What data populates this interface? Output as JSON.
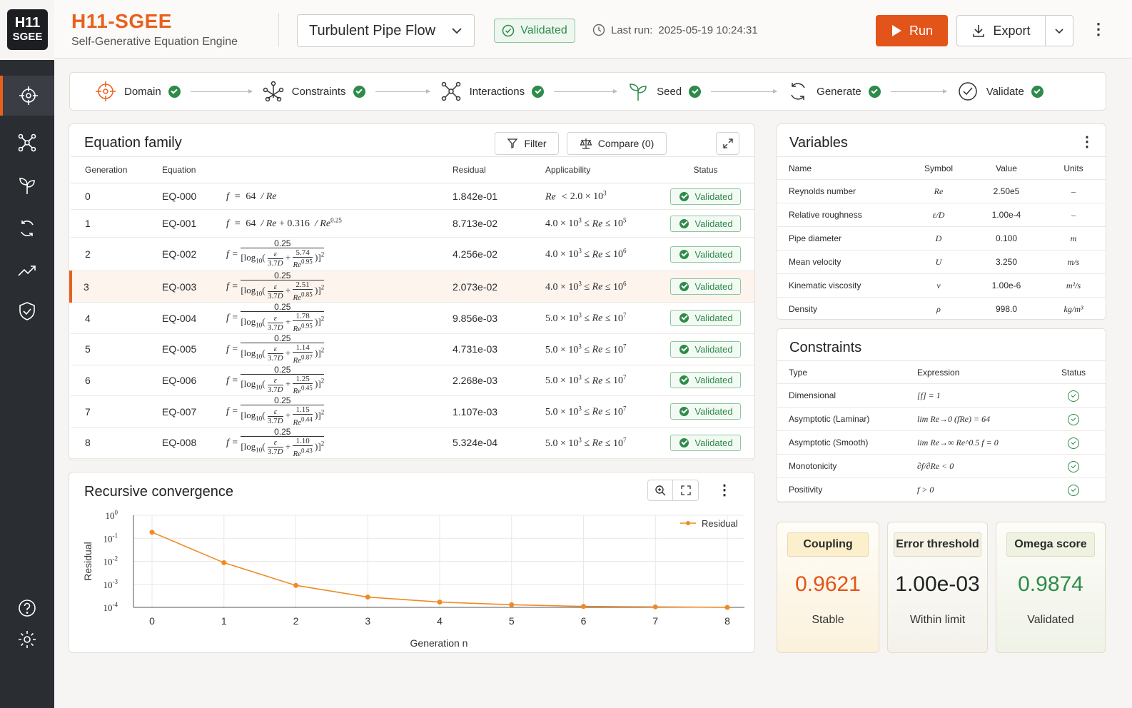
{
  "app": {
    "logo_line1": "H11",
    "logo_line2": "SGEE",
    "title": "H11-SGEE",
    "subtitle": "Self-Generative Equation Engine"
  },
  "header": {
    "dataset": "Turbulent Pipe Flow",
    "status_badge": "Validated",
    "last_run_label": "Last run:",
    "last_run_value": "2025-05-19 10:24:31",
    "run_label": "Run",
    "export_label": "Export",
    "accent": "#e3541a"
  },
  "pipeline": {
    "steps": [
      {
        "label": "Domain",
        "icon": "crosshair-icon"
      },
      {
        "label": "Constraints",
        "icon": "constraint-graph-icon"
      },
      {
        "label": "Interactions",
        "icon": "network-icon"
      },
      {
        "label": "Seed",
        "icon": "sprout-icon"
      },
      {
        "label": "Generate",
        "icon": "refresh-icon"
      },
      {
        "label": "Validate",
        "icon": "check-circle-icon"
      }
    ]
  },
  "equation_family": {
    "title": "Equation family",
    "filter_label": "Filter",
    "compare_label": "Compare (0)",
    "columns": [
      "Generation",
      "Equation",
      "",
      "Residual",
      "Applicability",
      "Status"
    ],
    "rows": [
      {
        "gen": "0",
        "id": "EQ-000",
        "residual": "1.842e-01",
        "status": "Validated"
      },
      {
        "gen": "1",
        "id": "EQ-001",
        "residual": "8.713e-02",
        "status": "Validated"
      },
      {
        "gen": "2",
        "id": "EQ-002",
        "residual": "4.256e-02",
        "status": "Validated",
        "num": "5.74",
        "exp": "0.95",
        "app_lo": "4.0",
        "app_lo_exp": "3",
        "app_hi_exp": "6"
      },
      {
        "gen": "3",
        "id": "EQ-003",
        "residual": "2.073e-02",
        "status": "Validated",
        "num": "2.51",
        "exp": "0.85",
        "app_lo": "4.0",
        "app_lo_exp": "3",
        "app_hi_exp": "6"
      },
      {
        "gen": "4",
        "id": "EQ-004",
        "residual": "9.856e-03",
        "status": "Validated",
        "num": "1.78",
        "exp": "0.95",
        "app_lo": "5.0",
        "app_lo_exp": "3",
        "app_hi_exp": "7"
      },
      {
        "gen": "5",
        "id": "EQ-005",
        "residual": "4.731e-03",
        "status": "Validated",
        "num": "1.14",
        "exp": "0.87",
        "app_lo": "5.0",
        "app_lo_exp": "3",
        "app_hi_exp": "7"
      },
      {
        "gen": "6",
        "id": "EQ-006",
        "residual": "2.268e-03",
        "status": "Validated",
        "num": "1.25",
        "exp": "0.45",
        "app_lo": "5.0",
        "app_lo_exp": "3",
        "app_hi_exp": "7"
      },
      {
        "gen": "7",
        "id": "EQ-007",
        "residual": "1.107e-03",
        "status": "Validated",
        "num": "1.15",
        "exp": "0.44",
        "app_lo": "5.0",
        "app_lo_exp": "3",
        "app_hi_exp": "7"
      },
      {
        "gen": "8",
        "id": "EQ-008",
        "residual": "5.324e-04",
        "status": "Validated",
        "num": "1.10",
        "exp": "0.43",
        "app_lo": "5.0",
        "app_lo_exp": "3",
        "app_hi_exp": "7"
      }
    ]
  },
  "convergence": {
    "title": "Recursive convergence"
  },
  "chart_data": {
    "type": "line",
    "title": "Recursive convergence",
    "xlabel": "Generation n",
    "ylabel": "Residual",
    "yscale": "log",
    "ylim": [
      0.0001,
      1
    ],
    "yticks": [
      "10^0",
      "10^-1",
      "10^-2",
      "10^-3",
      "10^-4"
    ],
    "x": [
      0,
      1,
      2,
      3,
      4,
      5,
      6,
      7,
      8
    ],
    "series": [
      {
        "name": "Residual",
        "color": "#f08a24",
        "values": [
          0.1842,
          0.008713,
          0.0009,
          0.00028,
          0.00017,
          0.00013,
          0.00011,
          0.000105,
          0.0001
        ]
      }
    ],
    "grid": true,
    "legend": "top-right"
  },
  "variables": {
    "title": "Variables",
    "columns": [
      "Name",
      "Symbol",
      "Value",
      "Units"
    ],
    "rows": [
      {
        "name": "Reynolds number",
        "symbol": "Re",
        "value": "2.50e5",
        "units": "–"
      },
      {
        "name": "Relative roughness",
        "symbol": "ε/D",
        "value": "1.00e-4",
        "units": "–"
      },
      {
        "name": "Pipe diameter",
        "symbol": "D",
        "value": "0.100",
        "units": "m"
      },
      {
        "name": "Mean velocity",
        "symbol": "U",
        "value": "3.250",
        "units": "m/s"
      },
      {
        "name": "Kinematic viscosity",
        "symbol": "ν",
        "value": "1.00e-6",
        "units": "m²/s"
      },
      {
        "name": "Density",
        "symbol": "ρ",
        "value": "998.0",
        "units": "kg/m³"
      }
    ]
  },
  "constraints": {
    "title": "Constraints",
    "columns": [
      "Type",
      "Expression",
      "Status"
    ],
    "rows": [
      {
        "type": "Dimensional",
        "expr": "[f] = 1"
      },
      {
        "type": "Asymptotic (Laminar)",
        "expr": "lim Re→0 (fRe) = 64"
      },
      {
        "type": "Asymptotic (Smooth)",
        "expr": "lim Re→∞ Re^0.5 f = 0"
      },
      {
        "type": "Monotonicity",
        "expr": "∂f/∂Re < 0"
      },
      {
        "type": "Positivity",
        "expr": "f > 0"
      }
    ]
  },
  "metrics": [
    {
      "label": "Coupling",
      "value": "0.9621",
      "sub": "Stable",
      "color": "#e3541a"
    },
    {
      "label": "Error threshold",
      "value": "1.00e-03",
      "sub": "Within limit",
      "color": "#222222"
    },
    {
      "label": "Omega score",
      "value": "0.9874",
      "sub": "Validated",
      "color": "#2e8b4a"
    }
  ]
}
